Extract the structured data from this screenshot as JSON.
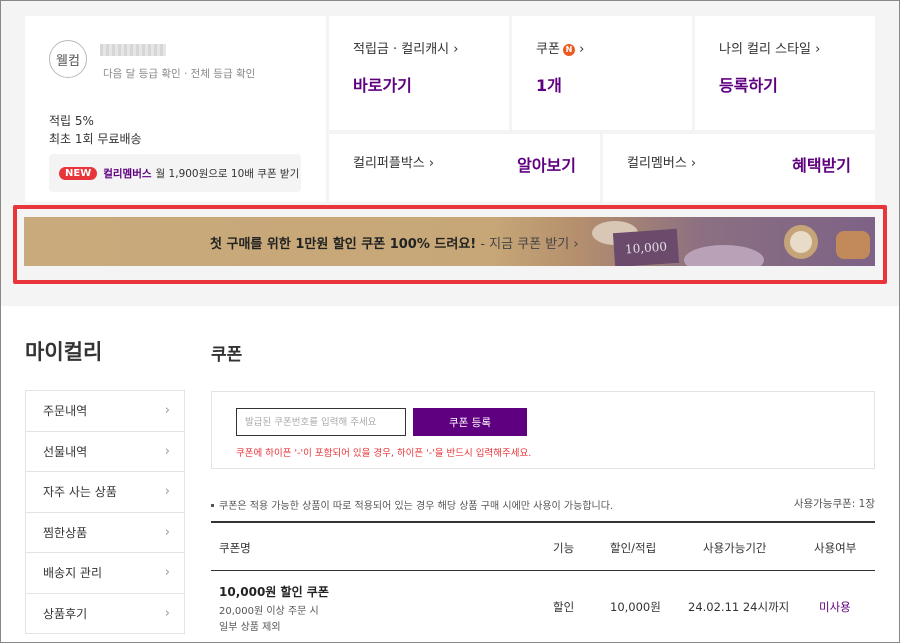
{
  "grade": {
    "circle": "웰컴",
    "links": "다음 달 등급 확인 · 전체 등급 확인",
    "line1": "적립 5%",
    "line2": "최초 1회 무료배송",
    "members_badge": "NEW",
    "members_name": "컬리멤버스",
    "members_desc": "월 1,900원으로 10배 쿠폰 받기",
    "arrow": "›"
  },
  "cards": {
    "point_title": "적립금 · 컬리캐시 ›",
    "point_value": "바로가기",
    "coupon_title": "쿠폰",
    "coupon_badge": "N",
    "coupon_arrow": "›",
    "coupon_value": "1개",
    "style_title": "나의 컬리 스타일 ›",
    "style_value": "등록하기",
    "purple_title": "컬리퍼플박스 ›",
    "purple_value": "알아보기",
    "members_title": "컬리멤버스 ›",
    "members_value": "혜택받기"
  },
  "banner": {
    "text_bold": "첫 구매를 위한 1만원 할인 쿠폰 100% 드려요!",
    "text_cta": " - 지금 쿠폰 받기 ›",
    "tag": "10,000"
  },
  "page_title": "마이컬리",
  "sidebar": {
    "items": [
      {
        "label": "주문내역"
      },
      {
        "label": "선물내역"
      },
      {
        "label": "자주 사는 상품"
      },
      {
        "label": "찜한상품"
      },
      {
        "label": "배송지 관리"
      },
      {
        "label": "상품후기"
      }
    ],
    "arrow": "›"
  },
  "section_title": "쿠폰",
  "register": {
    "placeholder": "발급된 쿠폰번호를 입력해 주세요",
    "button": "쿠폰 등록",
    "warning": "쿠폰에 하이픈 '-'이 포함되어 있을 경우, 하이픈 '-'을 반드시 입력해주세요."
  },
  "notice": "쿠폰은 적용 가능한 상품이 따로 적용되어 있는 경우 해당 상품 구매 시에만 사용이 가능합니다.",
  "usable_count": "사용가능쿠폰: 1장",
  "table": {
    "headers": {
      "name": "쿠폰명",
      "function": "기능",
      "discount": "할인/적립",
      "period": "사용가능기간",
      "status": "사용여부"
    },
    "rows": [
      {
        "name": "10,000원 할인 쿠폰",
        "condition": "20,000원 이상 주문 시",
        "exclusion": "일부 상품 제외",
        "function": "할인",
        "discount": "10,000원",
        "period": "24.02.11 24시까지",
        "status": "미사용"
      }
    ]
  },
  "colors": {
    "brand_purple": "#5f0080",
    "highlight_red": "#e8353a",
    "top_bg": "#f4f4f4"
  }
}
